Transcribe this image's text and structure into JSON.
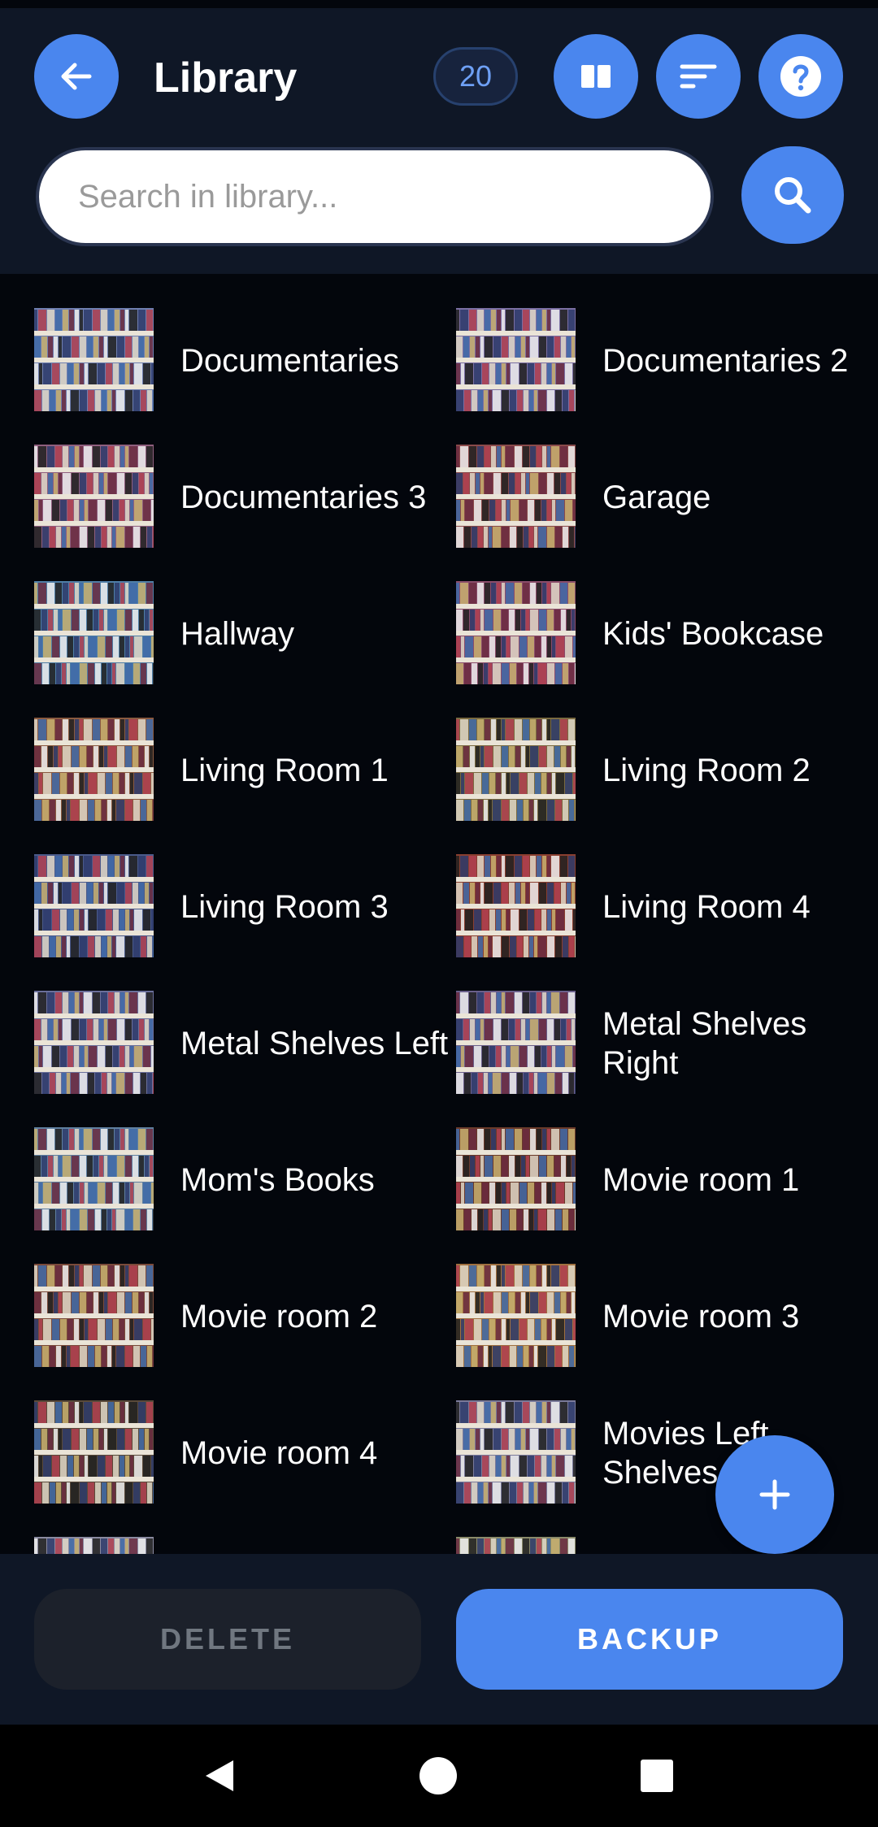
{
  "header": {
    "title": "Library",
    "count": "20",
    "search_placeholder": "Search in library..."
  },
  "icons": {
    "back": "arrow-left-icon",
    "view": "book-open-icon",
    "sort": "sort-icon",
    "help": "help-icon",
    "search": "search-icon",
    "add": "plus-icon"
  },
  "items": [
    {
      "label": "Documentaries",
      "tint": "#6f7fb0"
    },
    {
      "label": "Documentaries 2",
      "tint": "#7b6fa3"
    },
    {
      "label": "Documentaries 3",
      "tint": "#8f5f7e"
    },
    {
      "label": "Garage",
      "tint": "#8a4a4a"
    },
    {
      "label": "Hallway",
      "tint": "#4f7ea6"
    },
    {
      "label": "Kids' Bookcase",
      "tint": "#8a4c6a"
    },
    {
      "label": "Living Room 1",
      "tint": "#8a5a40"
    },
    {
      "label": "Living Room 2",
      "tint": "#7a6a40"
    },
    {
      "label": "Living Room 3",
      "tint": "#4a5a8a"
    },
    {
      "label": "Living Room 4",
      "tint": "#8a3f30"
    },
    {
      "label": "Metal Shelves Left",
      "tint": "#6a6f9a"
    },
    {
      "label": "Metal Shelves Right",
      "tint": "#6a5f8a"
    },
    {
      "label": "Mom's Books",
      "tint": "#5f7fa0"
    },
    {
      "label": "Movie room 1",
      "tint": "#6a3a2a"
    },
    {
      "label": "Movie room 2",
      "tint": "#7a4a3a"
    },
    {
      "label": "Movie room 3",
      "tint": "#a07040"
    },
    {
      "label": "Movie room 4",
      "tint": "#5a4a3a"
    },
    {
      "label": "Movies Left Shelves",
      "tint": "#7a7a9a"
    },
    {
      "label": "",
      "tint": "#8a8aa0"
    },
    {
      "label": "",
      "tint": "#8a8a6a"
    }
  ],
  "actions": {
    "delete": "DELETE",
    "backup": "BACKUP"
  },
  "colors": {
    "accent": "#4a86ee",
    "header_bg": "#0f1726",
    "page_bg": "#03060c"
  }
}
